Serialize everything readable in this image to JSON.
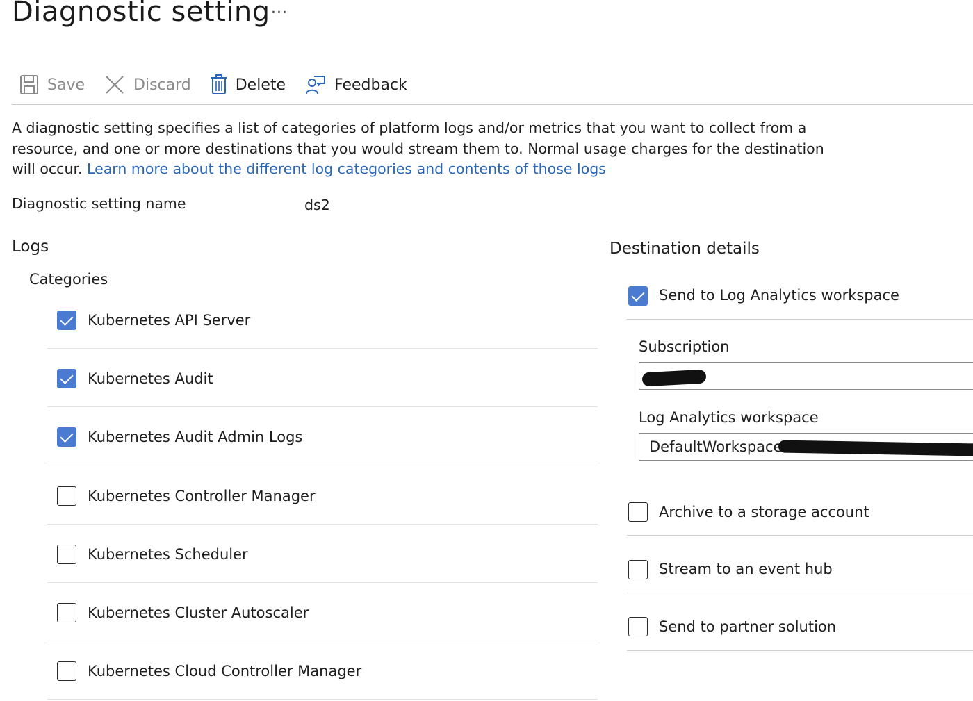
{
  "header": {
    "title": "Diagnostic setting",
    "more": "···"
  },
  "toolbar": {
    "save": "Save",
    "discard": "Discard",
    "delete": "Delete",
    "feedback": "Feedback"
  },
  "description": {
    "text": "A diagnostic setting specifies a list of categories of platform logs and/or metrics that you want to collect from a resource, and one or more destinations that you would stream them to. Normal usage charges for the destination will occur. ",
    "link": "Learn more about the different log categories and contents of those logs"
  },
  "name_field": {
    "label": "Diagnostic setting name",
    "value": "ds2"
  },
  "logs": {
    "heading": "Logs",
    "categories_heading": "Categories",
    "items": [
      {
        "label": "Kubernetes API Server",
        "checked": true
      },
      {
        "label": "Kubernetes Audit",
        "checked": true
      },
      {
        "label": "Kubernetes Audit Admin Logs",
        "checked": true
      },
      {
        "label": "Kubernetes Controller Manager",
        "checked": false
      },
      {
        "label": "Kubernetes Scheduler",
        "checked": false
      },
      {
        "label": "Kubernetes Cluster Autoscaler",
        "checked": false
      },
      {
        "label": "Kubernetes Cloud Controller Manager",
        "checked": false
      }
    ]
  },
  "destination": {
    "heading": "Destination details",
    "log_analytics": {
      "label": "Send to Log Analytics workspace",
      "checked": true
    },
    "subscription": {
      "label": "Subscription",
      "value": ""
    },
    "workspace": {
      "label": "Log Analytics workspace",
      "value": "DefaultWorkspace-3"
    },
    "storage": {
      "label": "Archive to a storage account",
      "checked": false
    },
    "event_hub": {
      "label": "Stream to an event hub",
      "checked": false
    },
    "partner": {
      "label": "Send to partner solution",
      "checked": false
    }
  },
  "colors": {
    "accent": "#4a7bd1",
    "link": "#2a66b8",
    "divider": "#c8c8c8"
  }
}
